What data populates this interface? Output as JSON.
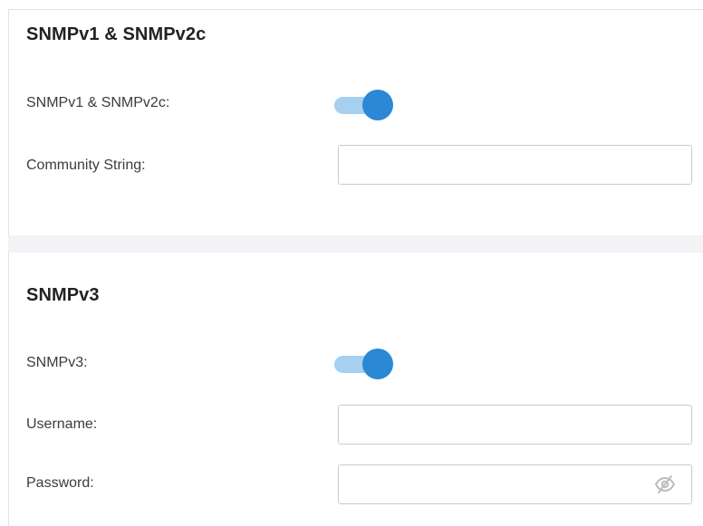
{
  "snmp_v1_v2c": {
    "title": "SNMPv1 & SNMPv2c",
    "toggle_label": "SNMPv1 & SNMPv2c:",
    "toggle_enabled": true,
    "community_label": "Community String:",
    "community_value": "",
    "community_placeholder": ""
  },
  "snmp_v3": {
    "title": "SNMPv3",
    "toggle_label": "SNMPv3:",
    "toggle_enabled": true,
    "username_label": "Username:",
    "username_value": "",
    "username_placeholder": "",
    "password_label": "Password:",
    "password_value": "",
    "password_placeholder": "",
    "password_visibility_icon": "eye-slash-icon"
  },
  "colors": {
    "accent": "#2a88d4",
    "toggle_track": "#a6cff0",
    "section_gap": "#f3f4f6",
    "input_border": "#cbcbcb"
  }
}
